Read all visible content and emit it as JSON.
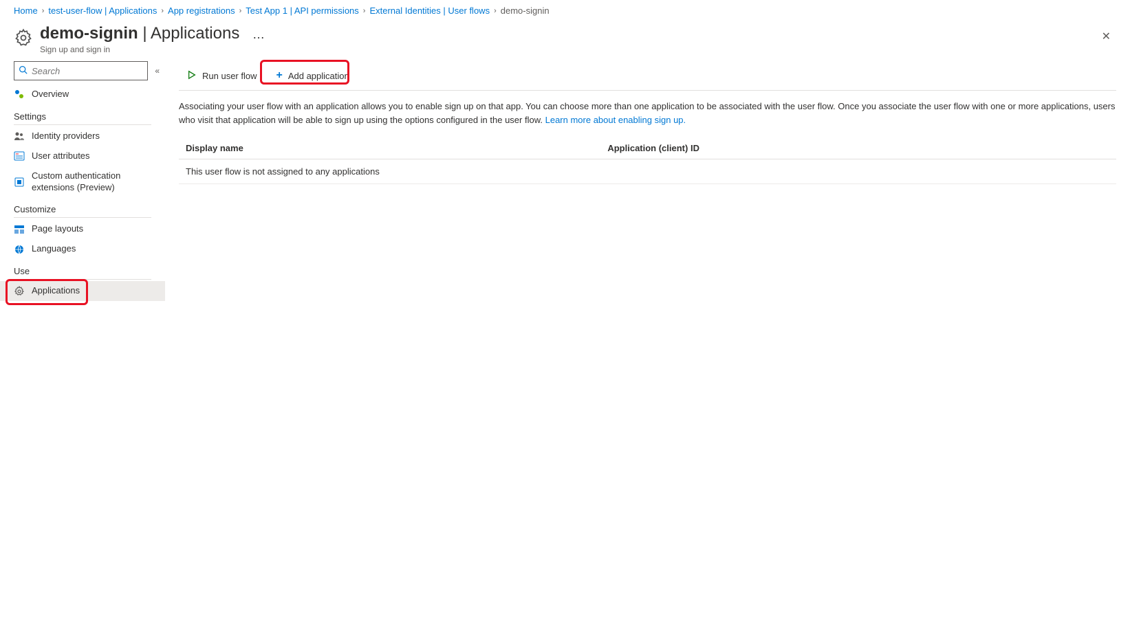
{
  "breadcrumb": [
    {
      "label": "Home"
    },
    {
      "label": "test-user-flow | Applications"
    },
    {
      "label": "App registrations"
    },
    {
      "label": "Test App 1 | API permissions"
    },
    {
      "label": "External Identities | User flows"
    },
    {
      "label": "demo-signin"
    }
  ],
  "header": {
    "title_strong": "demo-signin",
    "title_rest": " | Applications",
    "subtitle": "Sign up and sign in"
  },
  "search": {
    "placeholder": "Search"
  },
  "nav": {
    "overview": "Overview",
    "group_settings": "Settings",
    "identity_providers": "Identity providers",
    "user_attributes": "User attributes",
    "custom_auth": "Custom authentication extensions (Preview)",
    "group_customize": "Customize",
    "page_layouts": "Page layouts",
    "languages": "Languages",
    "group_use": "Use",
    "applications": "Applications"
  },
  "toolbar": {
    "run_user_flow": "Run user flow",
    "add_application": "Add application"
  },
  "description": {
    "text": "Associating your user flow with an application allows you to enable sign up on that app. You can choose more than one application to be associated with the user flow. Once you associate the user flow with one or more applications, users who visit that application will be able to sign up using the options configured in the user flow. ",
    "link": "Learn more about enabling sign up."
  },
  "table": {
    "col_display_name": "Display name",
    "col_app_id": "Application (client) ID",
    "empty": "This user flow is not assigned to any applications"
  }
}
